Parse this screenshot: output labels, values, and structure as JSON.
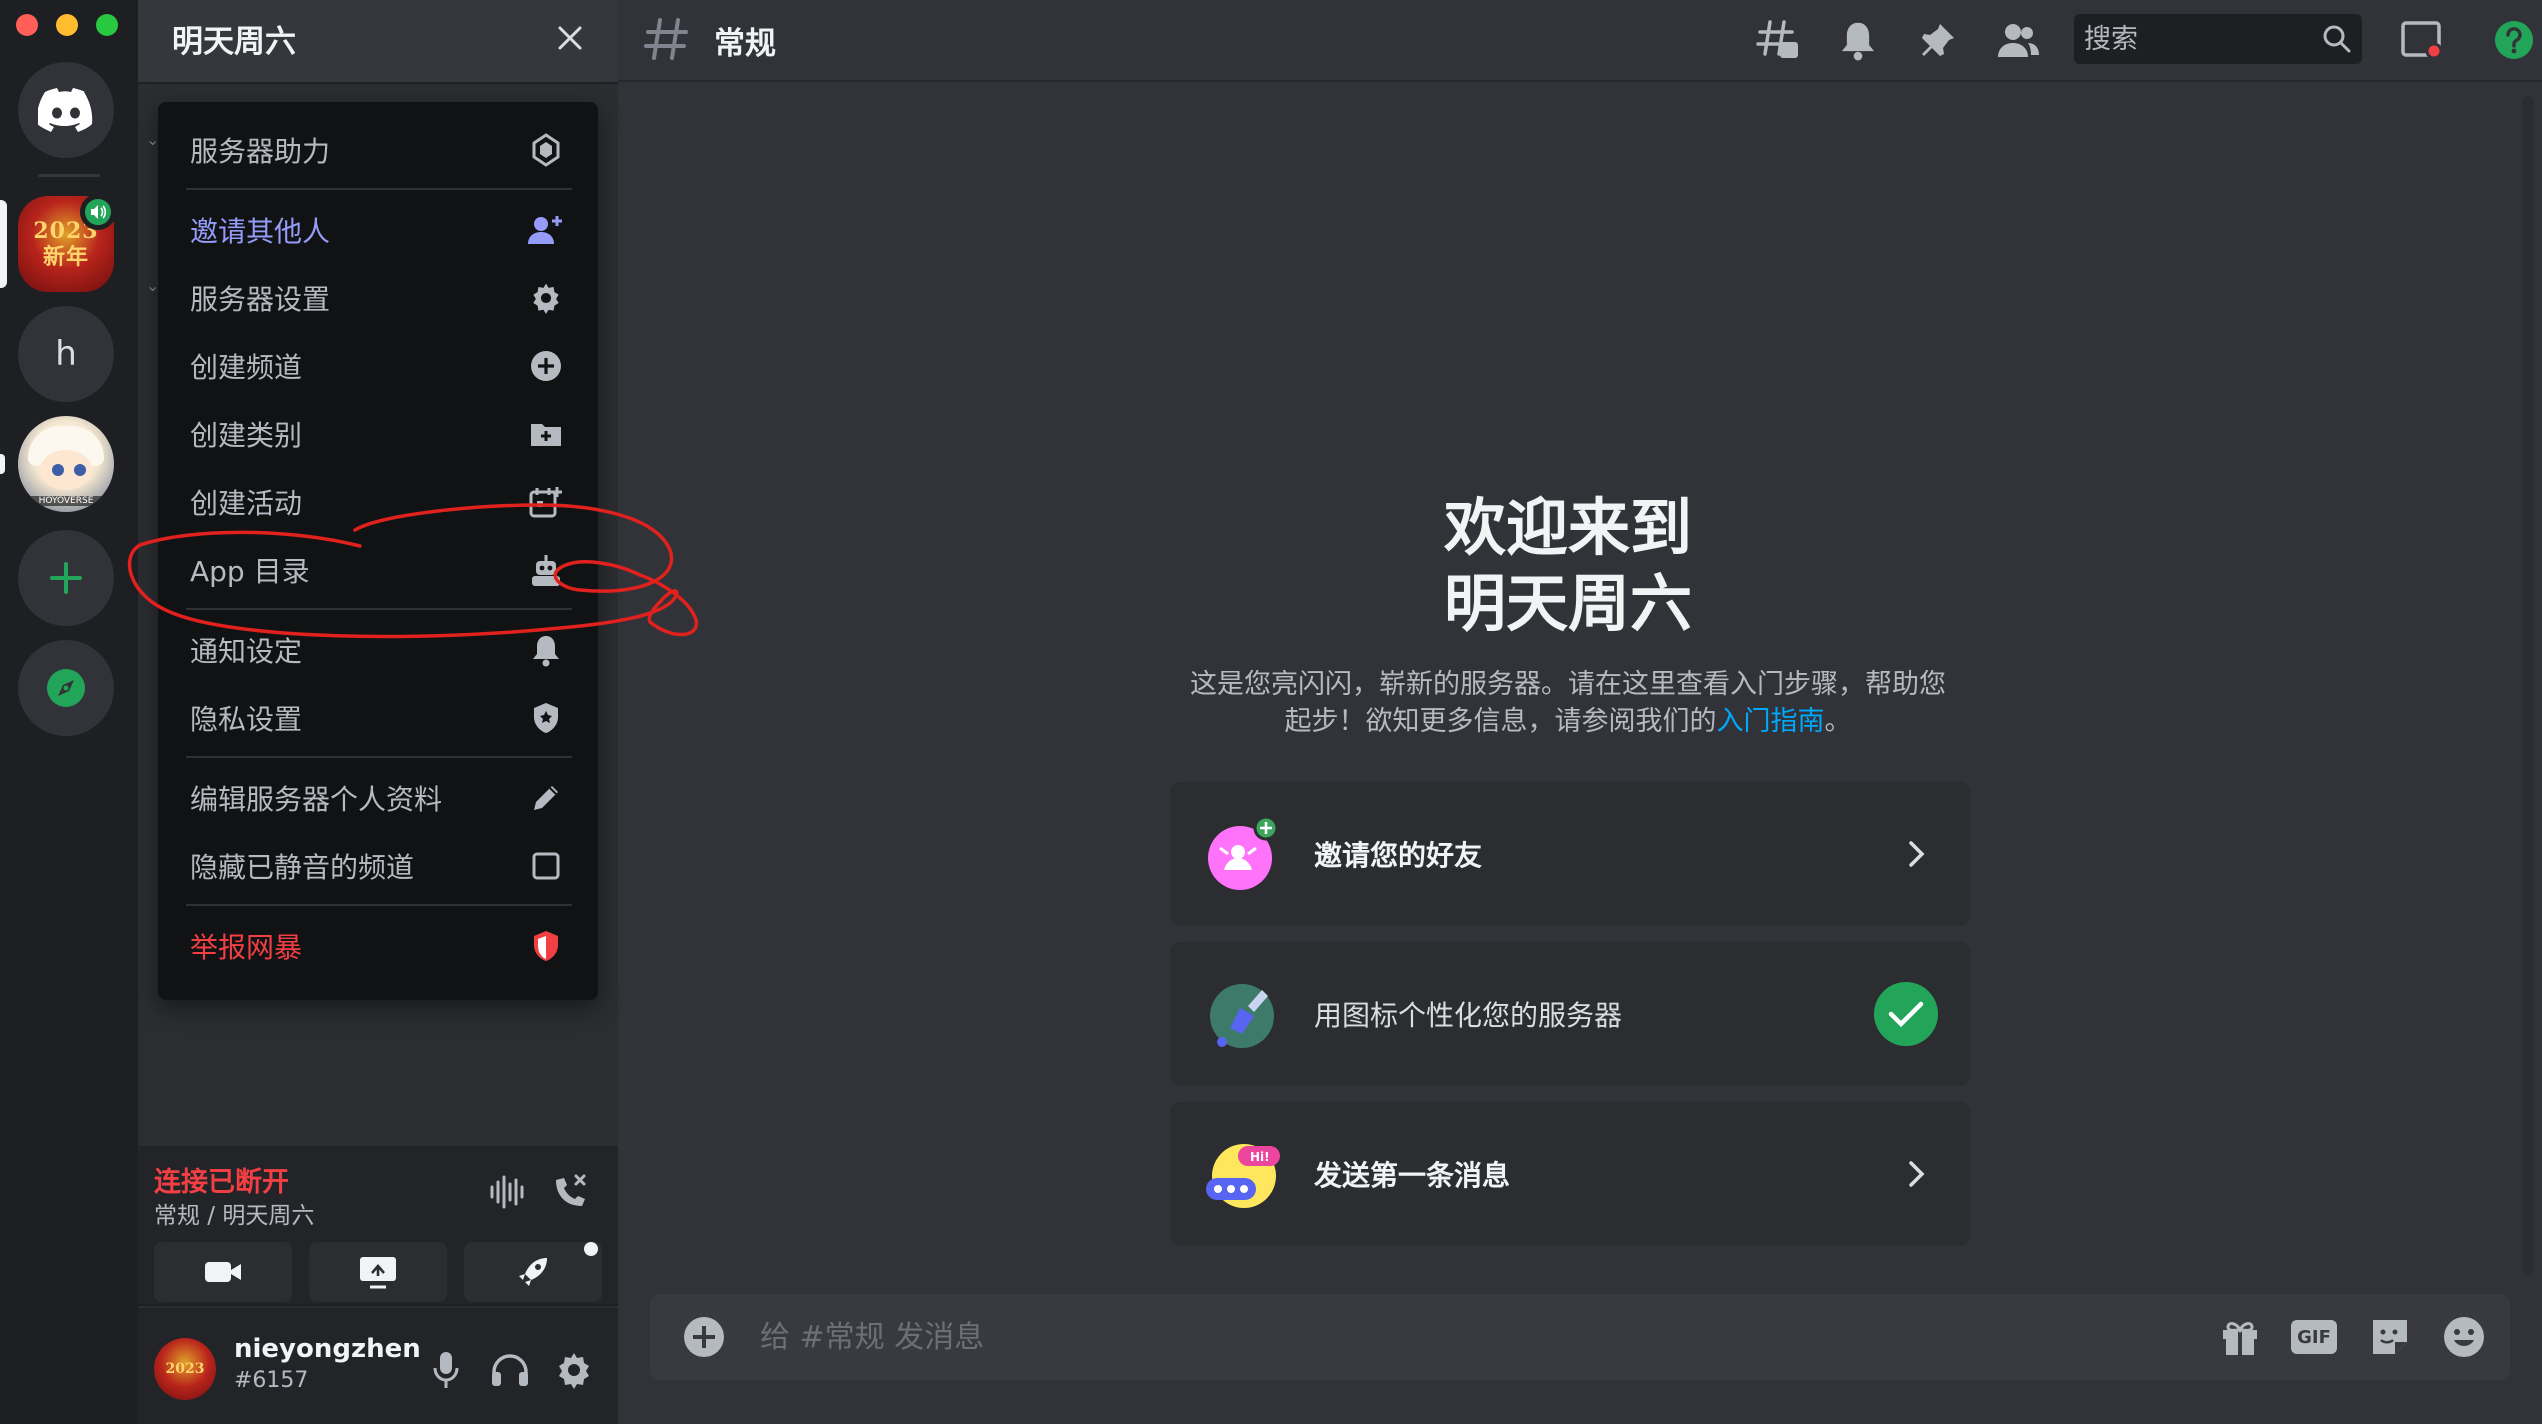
{
  "server": {
    "name": "明天周六"
  },
  "rail": {
    "home_letter": "h",
    "anime_tag": "HOYOVERSE",
    "guild_art": "2023\n新年"
  },
  "channel": {
    "name": "常规"
  },
  "menu": {
    "items": [
      {
        "key": "boost",
        "label": "服务器助力",
        "icon": "boost-gem-icon"
      },
      {
        "key": "invite",
        "label": "邀请其他人",
        "icon": "add-user-icon"
      },
      {
        "key": "settings",
        "label": "服务器设置",
        "icon": "gear-icon"
      },
      {
        "key": "create-channel",
        "label": "创建频道",
        "icon": "plus-circle-icon"
      },
      {
        "key": "create-category",
        "label": "创建类别",
        "icon": "folder-plus-icon"
      },
      {
        "key": "create-event",
        "label": "创建活动",
        "icon": "calendar-plus-icon"
      },
      {
        "key": "app-directory",
        "label": "App 目录",
        "icon": "robot-icon"
      },
      {
        "key": "notifications",
        "label": "通知设定",
        "icon": "bell-icon"
      },
      {
        "key": "privacy",
        "label": "隐私设置",
        "icon": "shield-icon"
      },
      {
        "key": "edit-profile",
        "label": "编辑服务器个人资料",
        "icon": "pencil-icon"
      },
      {
        "key": "hide-muted",
        "label": "隐藏已静音的频道",
        "icon": "checkbox-icon"
      },
      {
        "key": "report",
        "label": "举报网暴",
        "icon": "report-shield-icon"
      }
    ]
  },
  "header": {
    "search_placeholder": "搜索"
  },
  "welcome": {
    "title_line1": "欢迎来到",
    "title_line2": "明天周六",
    "desc_line1": "这是您亮闪闪，崭新的服务器。请在这里查看入门步骤，帮助您",
    "desc_line2_prefix": "起步！欲知更多信息，请参阅我们的",
    "desc_link": "入门指南",
    "desc_suffix": "。"
  },
  "cards": [
    {
      "label": "邀请您的好友",
      "done": false
    },
    {
      "label": "用图标个性化您的服务器",
      "done": true
    },
    {
      "label": "发送第一条消息",
      "done": false
    }
  ],
  "voice": {
    "status": "连接已断开",
    "location": "常规 / 明天周六"
  },
  "user": {
    "name": "nieyongzhen",
    "tag": "#6157",
    "avatar_art": "2023"
  },
  "composer": {
    "placeholder": "给 #常规 发消息",
    "gif_label": "GIF"
  },
  "colors": {
    "accent": "#5865f2",
    "danger": "#f23f43",
    "success": "#23a559",
    "link": "#00a8fc",
    "annotation": "#e0211d"
  }
}
